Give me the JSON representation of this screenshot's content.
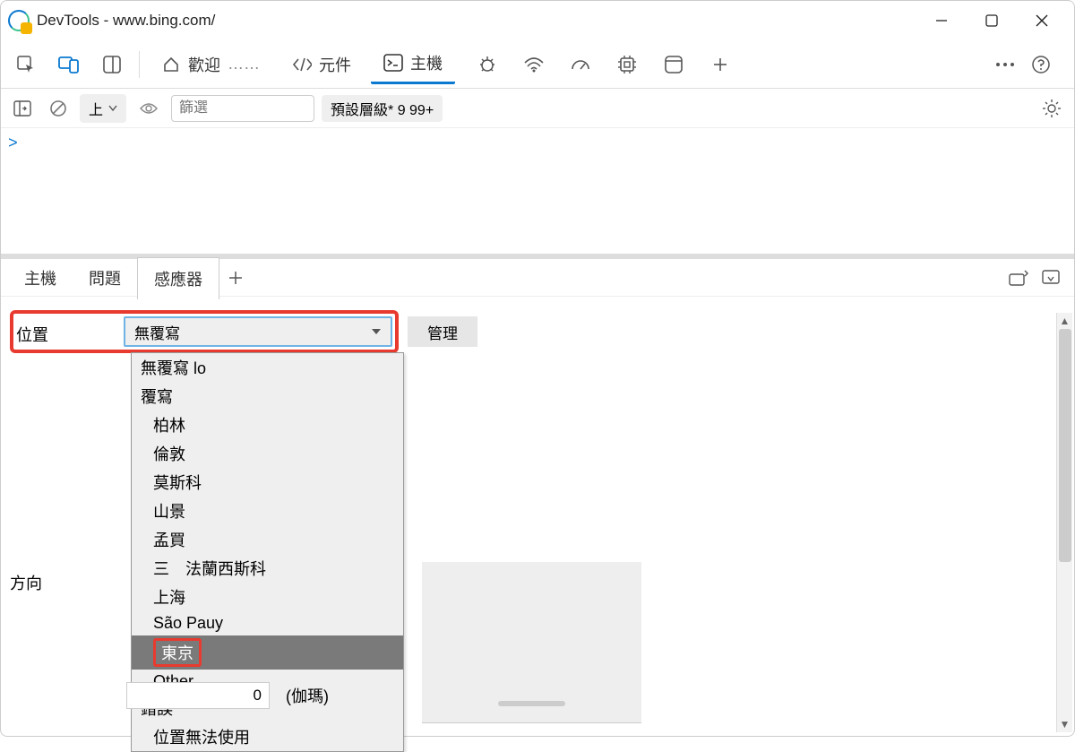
{
  "window": {
    "title": "DevTools - www.bing.com/"
  },
  "tabs": {
    "welcome": "歡迎",
    "elements": "元件",
    "console": "主機"
  },
  "toolbar": {
    "top_label": "上",
    "filter_placeholder": "篩選",
    "levels": "預設層級* 9 99+"
  },
  "drawer": {
    "tab_console": "主機",
    "tab_issues": "問題",
    "tab_sensors": "感應器"
  },
  "sensors": {
    "location_label": "位置",
    "location_value": "無覆寫",
    "manage": "管理",
    "orientation_label": "方向",
    "gamma_value": "0",
    "gamma_label": "(伽瑪)",
    "dropdown": {
      "no_override": "無覆寫 lo",
      "override": "覆寫",
      "berlin": "柏林",
      "london": "倫敦",
      "moscow": "莫斯科",
      "mountain_view": "山景",
      "mumbai": "孟買",
      "san_francisco": "三　法蘭西斯科",
      "shanghai": "上海",
      "sao_paulo": "São Pauy",
      "tokyo": "東京",
      "other": "Other...",
      "error": "錯誤",
      "unavailable": "位置無法使用"
    }
  }
}
